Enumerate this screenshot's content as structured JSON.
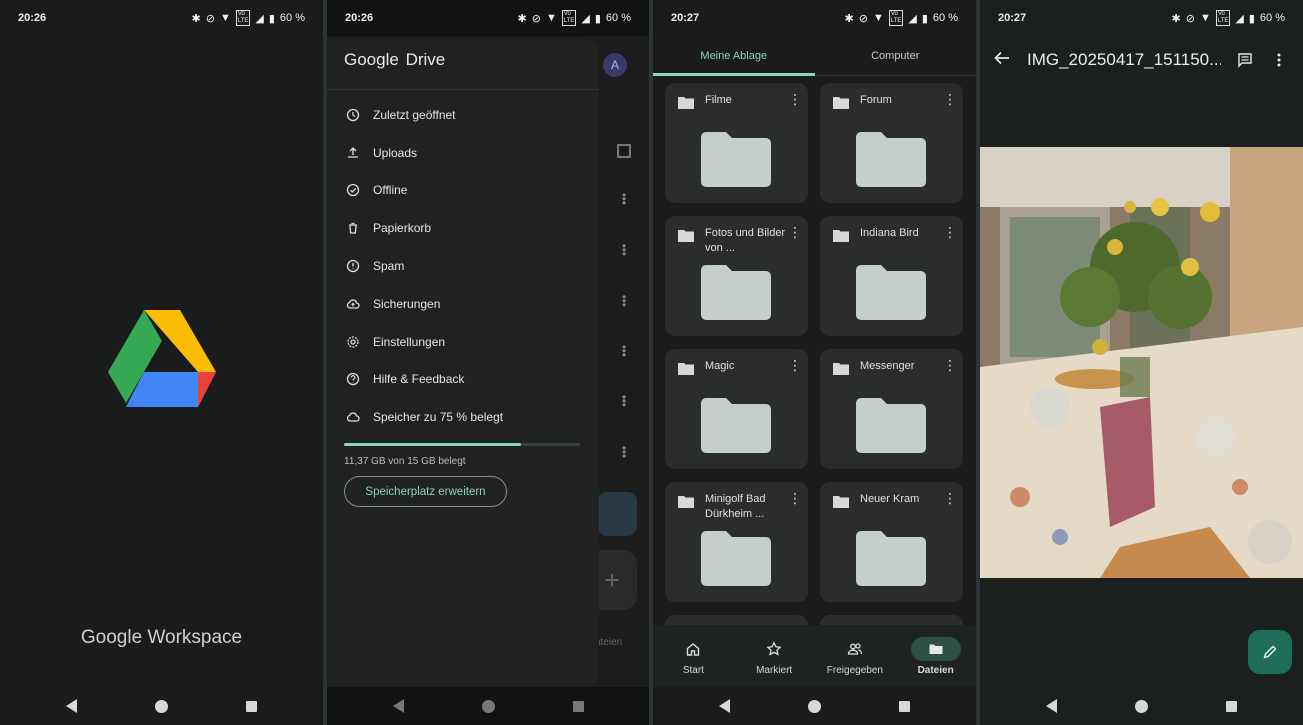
{
  "screens": {
    "splash": {
      "status_time": "20:26",
      "battery": "60 %",
      "brand_google": "Google",
      "brand_product": "Workspace"
    },
    "drawer": {
      "status_time": "20:26",
      "battery": "60 %",
      "title_google": "Google",
      "title_drive": "Drive",
      "avatar_letter": "A",
      "bg_tab_label": "ateien",
      "items": [
        {
          "label": "Zuletzt geöffnet",
          "icon": "clock-icon"
        },
        {
          "label": "Uploads",
          "icon": "upload-icon"
        },
        {
          "label": "Offline",
          "icon": "offline-icon"
        },
        {
          "label": "Papierkorb",
          "icon": "trash-icon"
        },
        {
          "label": "Spam",
          "icon": "spam-icon"
        },
        {
          "label": "Sicherungen",
          "icon": "backup-icon"
        },
        {
          "label": "Einstellungen",
          "icon": "settings-icon"
        },
        {
          "label": "Hilfe & Feedback",
          "icon": "help-icon"
        },
        {
          "label": "Speicher zu 75 % belegt",
          "icon": "cloud-icon"
        }
      ],
      "storage_fraction": 0.75,
      "storage_text": "11,37 GB von 15 GB belegt",
      "expand_button": "Speicherplatz erweitern"
    },
    "files": {
      "status_time": "20:27",
      "battery": "60 %",
      "tabs": [
        "Meine Ablage",
        "Computer"
      ],
      "folders": [
        {
          "name": "Filme"
        },
        {
          "name": "Forum"
        },
        {
          "name": "Fotos und Bilder von ..."
        },
        {
          "name": "Indiana Bird"
        },
        {
          "name": "Magic"
        },
        {
          "name": "Messenger"
        },
        {
          "name": "Minigolf Bad Dürkheim ..."
        },
        {
          "name": "Neuer Kram"
        }
      ],
      "bottom_nav": [
        "Start",
        "Markiert",
        "Freigegeben",
        "Dateien"
      ],
      "active_nav": "Dateien",
      "colors": {
        "accent": "#8ad3bc"
      }
    },
    "viewer": {
      "status_time": "20:27",
      "battery": "60 %",
      "title": "IMG_20250417_151150...."
    }
  }
}
